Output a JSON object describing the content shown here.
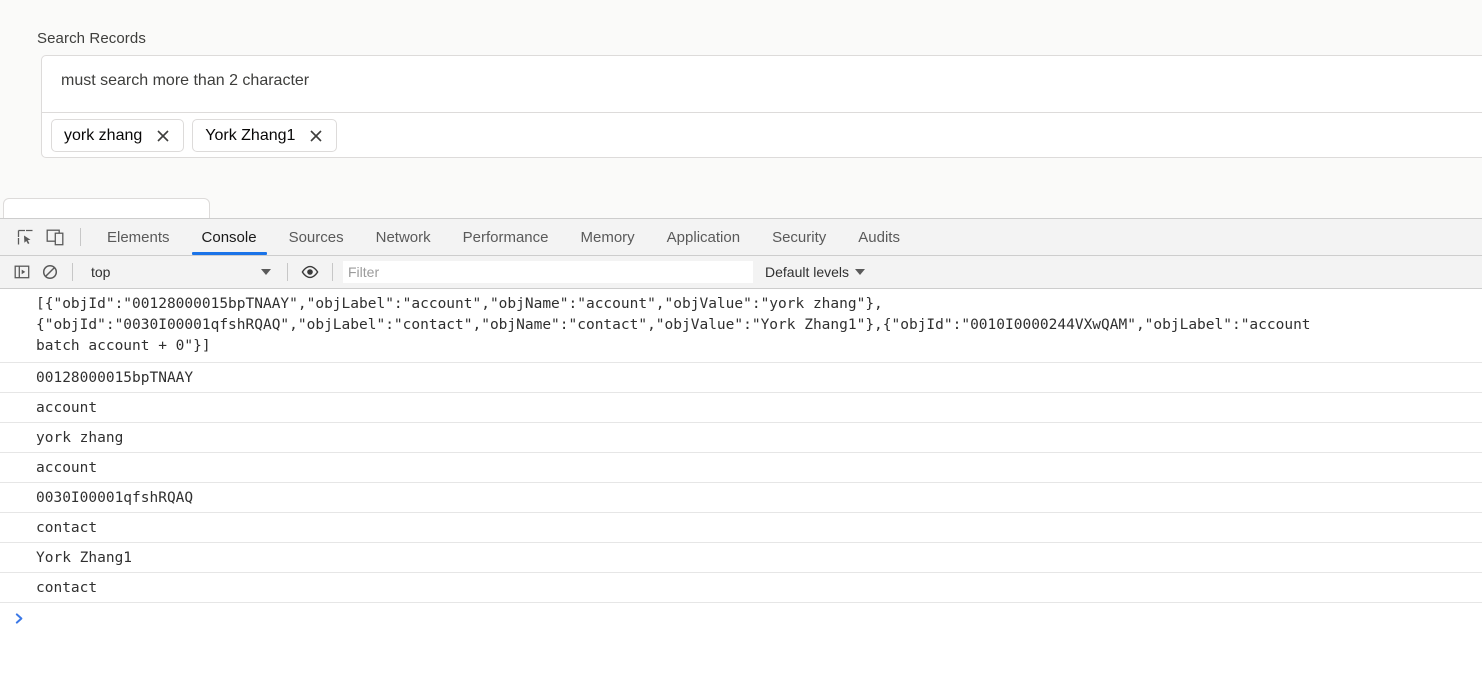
{
  "page": {
    "search_label": "Search Records",
    "search_input_value": "must search more than 2 character",
    "search_input_placeholder": "Search Records",
    "chips": [
      {
        "label": "york zhang",
        "close_icon": "close-icon"
      },
      {
        "label": "York Zhang1",
        "close_icon": "close-icon"
      }
    ],
    "colors": {
      "background": "#fafaf9",
      "field_background": "#ffffff",
      "border": "#dddbda",
      "text": "#3e3e3c"
    }
  },
  "devtools": {
    "toolbar_icons": [
      {
        "name": "inspect-element-icon"
      },
      {
        "name": "device-toolbar-icon"
      }
    ],
    "tabs": [
      {
        "label": "Elements",
        "active": false
      },
      {
        "label": "Console",
        "active": true
      },
      {
        "label": "Sources",
        "active": false
      },
      {
        "label": "Network",
        "active": false
      },
      {
        "label": "Performance",
        "active": false
      },
      {
        "label": "Memory",
        "active": false
      },
      {
        "label": "Application",
        "active": false
      },
      {
        "label": "Security",
        "active": false
      },
      {
        "label": "Audits",
        "active": false
      }
    ],
    "console_toolbar": {
      "sidebar_toggle_icon": "console-sidebar-icon",
      "clear_console_icon": "clear-console-icon",
      "context_value": "top",
      "eye_icon": "live-expression-eye-icon",
      "filter_placeholder": "Filter",
      "filter_value": "",
      "levels_label": "Default levels"
    },
    "active_tab_underline_color": "#1a73e8",
    "prompt": {
      "chevron_icon": "prompt-chevron-icon",
      "chevron_color": "#3b78e7",
      "input_value": ""
    },
    "log_entries": [
      {
        "type": "json-multiline",
        "lines": [
          "[{\"objId\":\"00128000015bpTNAAY\",\"objLabel\":\"account\",\"objName\":\"account\",\"objValue\":\"york zhang\"},",
          "{\"objId\":\"0030I00001qfshRQAQ\",\"objLabel\":\"contact\",\"objName\":\"contact\",\"objValue\":\"York Zhang1\"},{\"objId\":\"0010I0000244VXwQAM\",\"objLabel\":\"account",
          "batch account + 0\"}]"
        ]
      },
      {
        "type": "plain",
        "text": "00128000015bpTNAAY"
      },
      {
        "type": "plain",
        "text": "account"
      },
      {
        "type": "plain",
        "text": "york zhang"
      },
      {
        "type": "plain",
        "text": "account"
      },
      {
        "type": "plain",
        "text": "0030I00001qfshRQAQ"
      },
      {
        "type": "plain",
        "text": "contact"
      },
      {
        "type": "plain",
        "text": "York Zhang1"
      },
      {
        "type": "plain",
        "text": "contact"
      }
    ]
  }
}
